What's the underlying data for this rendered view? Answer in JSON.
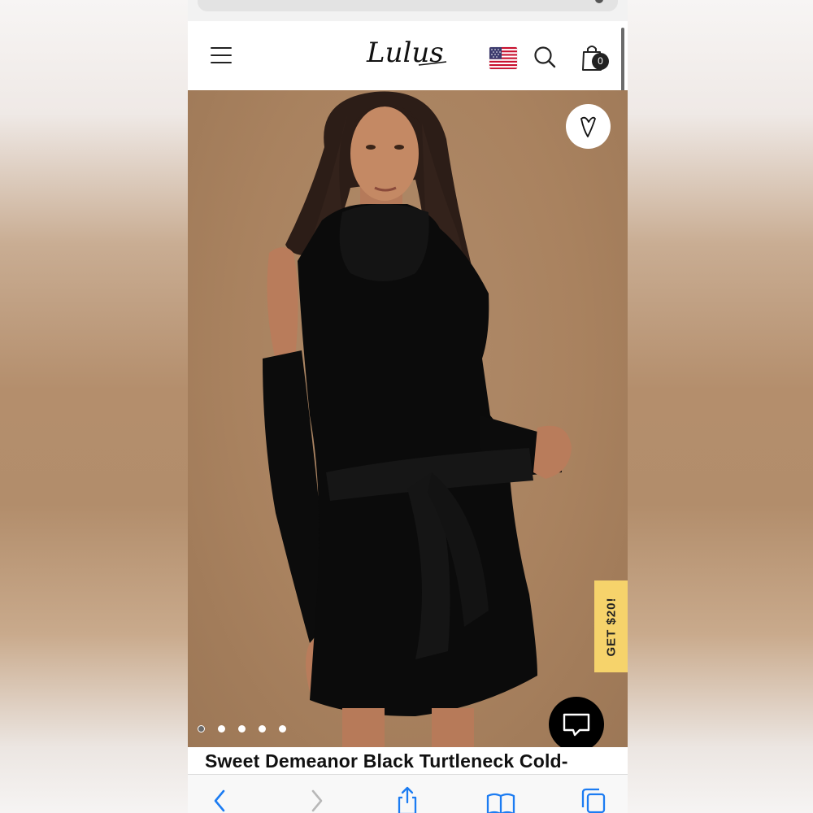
{
  "header": {
    "logo_text": "Lulus",
    "cart_count": "0",
    "region_flag": "us-flag-icon"
  },
  "hero": {
    "promo_label": "GET $20!",
    "image_count": 5,
    "active_image": 1
  },
  "product": {
    "title": "Sweet Demeanor Black Turtleneck Cold-"
  },
  "toolbar": {
    "items": [
      "back-icon",
      "forward-icon",
      "share-icon",
      "bookmarks-icon",
      "tabs-icon"
    ]
  },
  "colors": {
    "brand_black": "#111111",
    "promo_yellow": "#f6d36b",
    "hero_bg": "#a9825f",
    "ios_blue": "#1c7cf2"
  }
}
